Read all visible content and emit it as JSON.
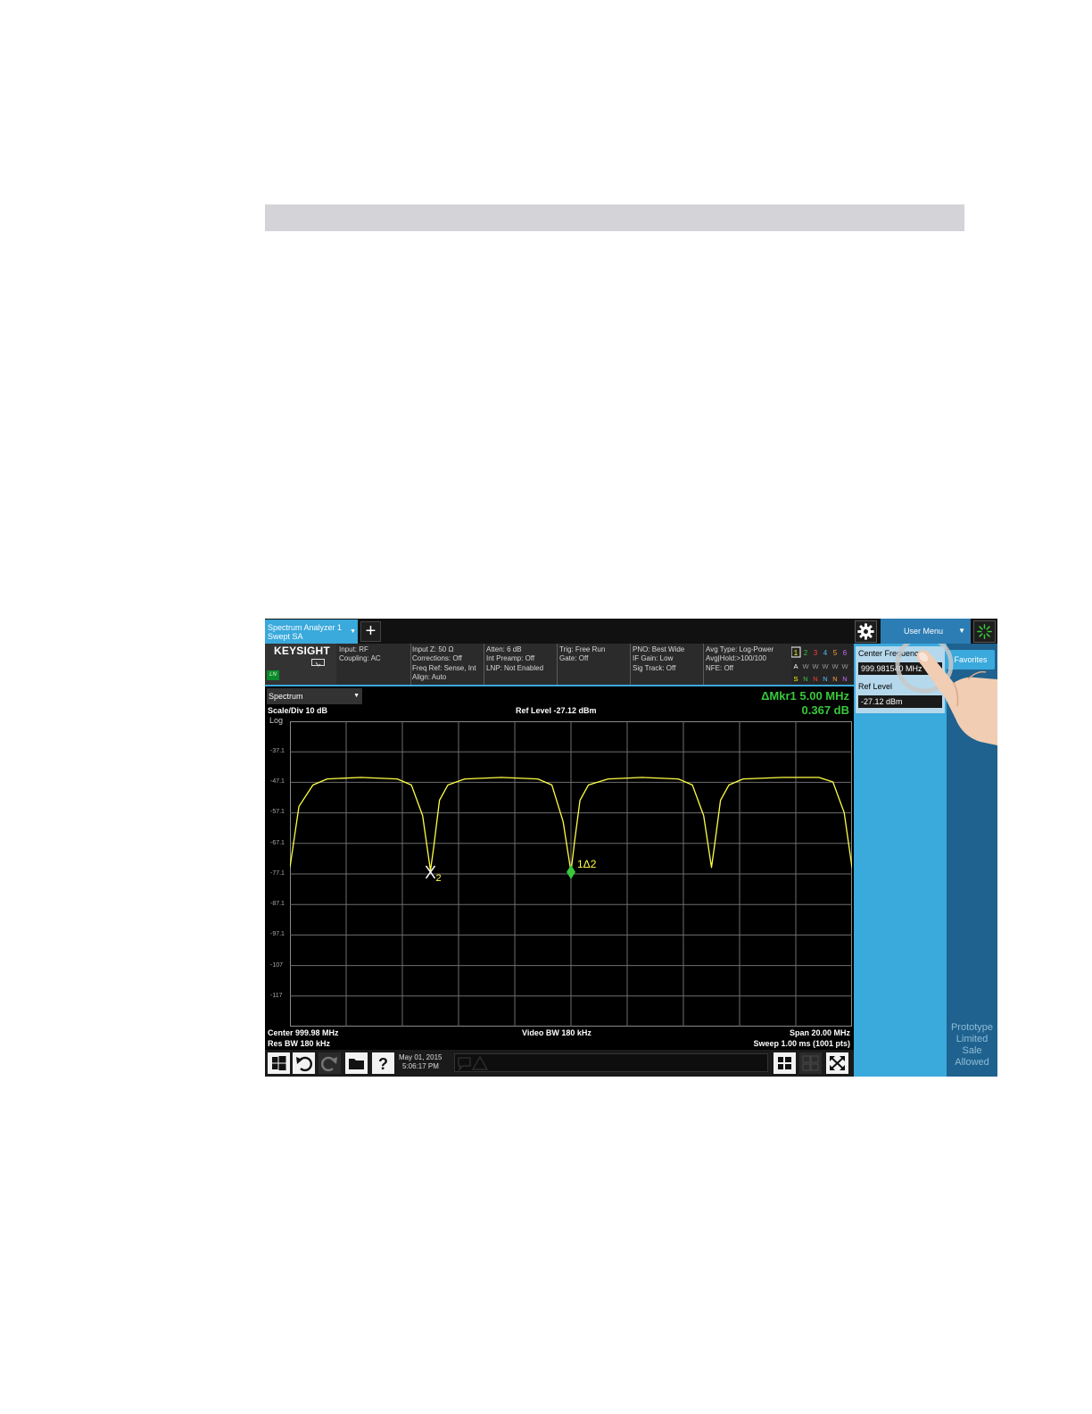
{
  "tab": {
    "line1": "Spectrum Analyzer 1",
    "line2": "Swept SA"
  },
  "logo": "KEYSIGHT",
  "ln_badge": "LN",
  "user_menu": "User Menu",
  "status": {
    "col1": [
      "Input: RF",
      "Coupling: AC"
    ],
    "col2": [
      "Input Z: 50 Ω",
      "Corrections: Off",
      "Freq Ref: Sense, Int",
      "Align: Auto"
    ],
    "col3": [
      "Atten: 6 dB",
      "Int Preamp: Off",
      "LNP: Not Enabled"
    ],
    "col4": [
      "Trig: Free Run",
      "Gate: Off"
    ],
    "col5": [
      "PNO: Best Wide",
      "IF Gain: Low",
      "Sig Track: Off"
    ],
    "col6": [
      "Avg Type: Log-Power",
      "Avg|Hold:>100/100",
      "NFE: Off"
    ]
  },
  "trace_indicator": {
    "numbers": [
      "1",
      "2",
      "3",
      "4",
      "5",
      "6"
    ],
    "row2": [
      "A",
      "W",
      "W",
      "W",
      "W",
      "W"
    ],
    "row3": [
      "S",
      "N",
      "N",
      "N",
      "N",
      "N"
    ],
    "colors": [
      "#ffff00",
      "#39c83b",
      "#ff3b3b",
      "#58b7ff",
      "#ff9d3b",
      "#c86bff"
    ]
  },
  "view_select": "Spectrum",
  "marker_readout": {
    "line1": "ΔMkr1  5.00 MHz",
    "line2": "0.367 dB"
  },
  "scale_label": "Scale/Div 10 dB",
  "scale_type": "Log",
  "ref_level_label": "Ref Level -27.12 dBm",
  "bottom": {
    "center": "Center 999.98 MHz",
    "res_bw": "Res BW 180 kHz",
    "video_bw": "Video BW 180 kHz",
    "span": "Span 20.00 MHz",
    "sweep": "Sweep 1.00 ms (1001 pts)"
  },
  "datetime": {
    "date": "May 01, 2015",
    "time": "5:06:17 PM"
  },
  "right_panel": {
    "favorites": "Favorites",
    "params": [
      {
        "label": "Center Frequency",
        "value": "999.981540 MHz"
      },
      {
        "label": "Ref Level",
        "value": "-27.12 dBm"
      }
    ],
    "prototype_notice": [
      "Prototype",
      "Limited",
      "Sale",
      "Allowed"
    ]
  },
  "chart_data": {
    "type": "line",
    "xlabel": "",
    "ylabel": "",
    "y_ticks": [
      "-37.1",
      "-47.1",
      "-57.1",
      "-67.1",
      "-77.1",
      "-87.1",
      "-97.1",
      "-107",
      "-117"
    ],
    "ylim": [
      -127.12,
      -27.12
    ],
    "x_range_mhz": [
      989.98,
      1009.98
    ],
    "grid": true,
    "trace_color": "#ffff44",
    "series": [
      {
        "x": [
          989.98,
          990.3,
          990.8,
          991.3,
          992.5,
          993.8,
          994.3,
          994.7,
          994.98,
          995.1,
          995.3,
          995.6,
          996.2,
          997.5,
          998.8,
          999.3,
          999.7,
          999.98,
          1000.1,
          1000.3,
          1000.6,
          1001.3,
          1002.5,
          1003.8,
          1004.3,
          1004.7,
          1004.98,
          1005.1,
          1005.3,
          1005.6,
          1006.1,
          1007.5,
          1008.8,
          1009.3,
          1009.7,
          1009.98
        ],
        "y": [
          -75,
          -55,
          -48,
          -46,
          -45.5,
          -46,
          -48,
          -58,
          -76,
          -68,
          -53,
          -48,
          -46,
          -45.5,
          -46,
          -48,
          -60,
          -76.5,
          -67,
          -53,
          -48,
          -46,
          -45.5,
          -46,
          -48,
          -58,
          -75,
          -67,
          -53,
          -48,
          -46,
          -45.5,
          -45.5,
          -47,
          -57,
          -75
        ]
      }
    ],
    "markers": [
      {
        "label": "1Δ2",
        "x": 999.98,
        "y": -76.5,
        "color": "#39c83b"
      },
      {
        "label": "X2",
        "x": 994.98,
        "y": -76.5,
        "color": "#ffffff"
      }
    ]
  }
}
